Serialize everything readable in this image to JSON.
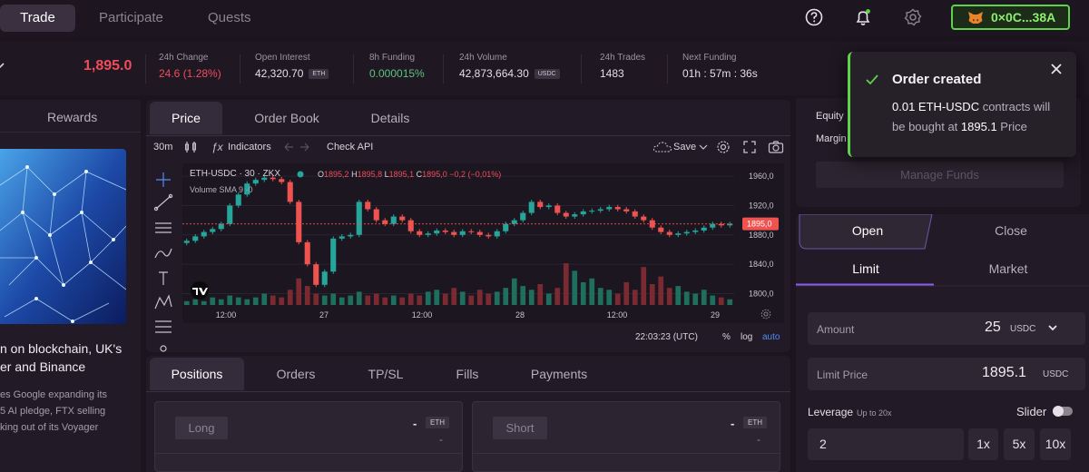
{
  "nav": {
    "tabs": [
      {
        "label": "Trade",
        "active": true
      },
      {
        "label": "Participate",
        "active": false
      },
      {
        "label": "Quests",
        "active": false
      }
    ],
    "icons": [
      "help-icon",
      "bell-icon",
      "gear-icon"
    ],
    "wallet": {
      "label": "0×0C...38A",
      "icon": "metamask-fox-icon",
      "border_color": "#5fd14b"
    }
  },
  "ticker": {
    "price": "1,895.0",
    "price_color": "#f04d5b",
    "stats": [
      {
        "label": "24h Change",
        "value": "24.6 (1.28%)",
        "color": "#f04d5b"
      },
      {
        "label": "Open Interest",
        "value": "42,320.70",
        "badge": "ETH"
      },
      {
        "label": "8h Funding",
        "value": "0.000015%",
        "color": "#5cc47a"
      },
      {
        "label": "24h Volume",
        "value": "42,873,664.30",
        "badge": "USDC"
      },
      {
        "label": "24h Trades",
        "value": "1483"
      },
      {
        "label": "Next Funding",
        "value": "01h : 57m : 36s"
      }
    ]
  },
  "left": {
    "tab": "Rewards",
    "headline": [
      "n on blockchain, UK's",
      "er and Binance"
    ],
    "body": [
      "es Google expanding its",
      "5 AI pledge, FTX selling",
      "king out of its Voyager"
    ]
  },
  "chart_panel": {
    "tabs": [
      "Price",
      "Order Book",
      "Details"
    ],
    "active_tab": "Price",
    "toolbar": {
      "interval": "30m",
      "indicators": "Indicators",
      "check_api": "Check API",
      "save": "Save"
    },
    "legend": {
      "symbol": "ETH-USDC · 30 · ZKX",
      "o": "1895,2",
      "h": "1895,8",
      "l": "1895,1",
      "c": "1895,0",
      "chg": "−0,2 (−0,01%)",
      "volume": "Volume SMA 9 ·0"
    },
    "time_readout": "22:03:23 (UTC)",
    "scale_opts": [
      "%",
      "log",
      "auto"
    ]
  },
  "chart_data": {
    "type": "candlestick",
    "symbol": "ETH-USDC",
    "y_ticks": [
      "1960,0",
      "1920,0",
      "1880,0",
      "1840,0",
      "1800,0"
    ],
    "ylim": [
      1792,
      1970
    ],
    "x_ticks": [
      "12:00",
      "27",
      "12:00",
      "28",
      "12:00",
      "29"
    ],
    "last_price": "1895,0",
    "closes": [
      1872,
      1878,
      1884,
      1888,
      1895,
      1920,
      1935,
      1950,
      1955,
      1958,
      1956,
      1952,
      1925,
      1870,
      1840,
      1812,
      1830,
      1875,
      1878,
      1880,
      1925,
      1915,
      1900,
      1895,
      1905,
      1900,
      1885,
      1880,
      1882,
      1886,
      1884,
      1880,
      1885,
      1884,
      1880,
      1878,
      1885,
      1895,
      1900,
      1910,
      1925,
      1918,
      1920,
      1910,
      1905,
      1908,
      1912,
      1913,
      1915,
      1918,
      1915,
      1912,
      1905,
      1900,
      1890,
      1884,
      1880,
      1882,
      1884,
      1886,
      1890,
      1895,
      1893,
      1895
    ],
    "volumes": [
      2,
      3,
      2,
      4,
      3,
      5,
      4,
      3,
      4,
      6,
      5,
      4,
      8,
      14,
      10,
      6,
      5,
      6,
      4,
      5,
      7,
      5,
      6,
      4,
      5,
      4,
      6,
      5,
      7,
      8,
      6,
      9,
      7,
      5,
      8,
      6,
      7,
      9,
      14,
      10,
      8,
      11,
      6,
      9,
      22,
      18,
      12,
      14,
      9,
      8,
      6,
      12,
      8,
      20,
      11,
      15,
      9,
      10,
      7,
      6,
      8,
      5,
      4,
      3
    ]
  },
  "bottom": {
    "tabs": [
      "Positions",
      "Orders",
      "TP/SL",
      "Fills",
      "Payments"
    ],
    "active_tab": "Positions",
    "cards": [
      {
        "label": "Long",
        "amount": "-",
        "asset": "ETH",
        "sub": "-"
      },
      {
        "label": "Short",
        "amount": "-",
        "asset": "ETH",
        "sub": "-"
      }
    ]
  },
  "right": {
    "account": {
      "equity_label": "Equity",
      "margin_label": "Margin",
      "manage_funds": "Manage Funds"
    },
    "side_tabs": [
      "Open",
      "Close"
    ],
    "order_tabs": [
      "Limit",
      "Market"
    ],
    "amount": {
      "label": "Amount",
      "value": "25",
      "unit": "USDC"
    },
    "limit_price": {
      "label": "Limit Price",
      "value": "1895.1",
      "unit": "USDC"
    },
    "leverage": {
      "label": "Leverage",
      "hint": "Up to 20x",
      "slider_label": "Slider",
      "value": "2",
      "presets": [
        "1x",
        "5x",
        "10x"
      ]
    }
  },
  "toast": {
    "title": "Order created",
    "line1_bold": "0.01 ETH-USDC",
    "line1_rest": " contracts will",
    "line2_pre": "be bought at ",
    "line2_bold": "1895.1",
    "line2_post": " Price"
  }
}
